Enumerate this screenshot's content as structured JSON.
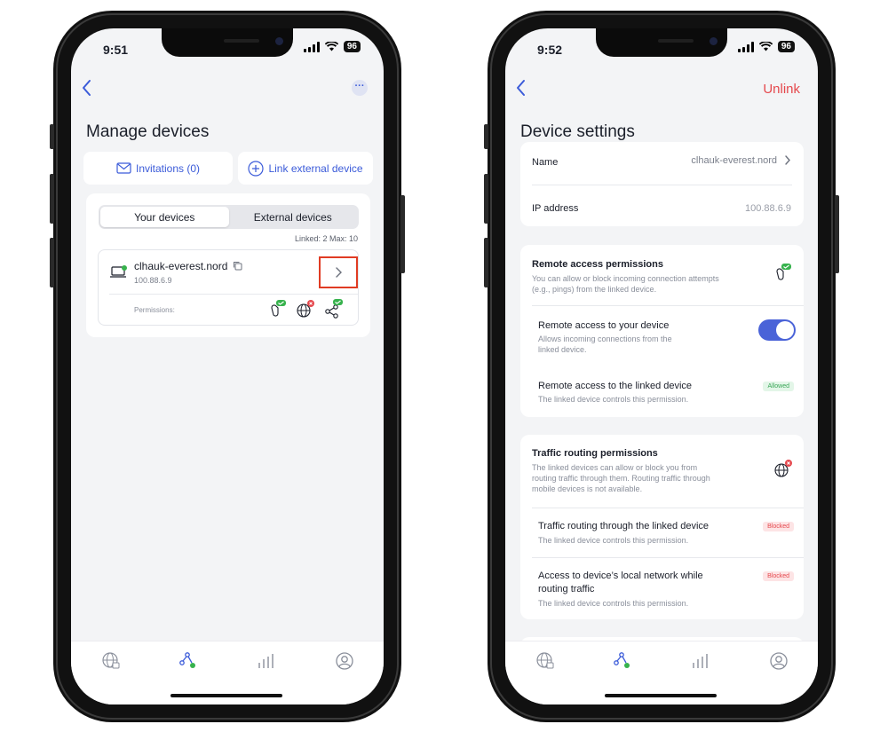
{
  "left": {
    "status": {
      "time": "9:51",
      "battery": "96"
    },
    "title": "Manage devices",
    "invitations_label": "Invitations (0)",
    "link_label": "Link external device",
    "tabs": {
      "your": "Your devices",
      "external": "External devices"
    },
    "linked_info": "Linked: 2  Max: 10",
    "device": {
      "name": "clhauk-everest.nord",
      "ip": "100.88.6.9"
    },
    "permissions_label": "Permissions:"
  },
  "right": {
    "status": {
      "time": "9:52",
      "battery": "96"
    },
    "unlink_label": "Unlink",
    "title": "Device settings",
    "name_label": "Name",
    "name_value": "clhauk-everest.nord",
    "ip_label": "IP address",
    "ip_value": "100.88.6.9",
    "remote": {
      "title": "Remote access permissions",
      "desc1": "You can allow or block incoming connection attempts",
      "desc2": "(e.g., pings) from the linked device.",
      "item1_title": "Remote access to your device",
      "item1_desc1": "Allows incoming connections from the",
      "item1_desc2": "linked device.",
      "item2_title": "Remote access to the linked device",
      "item2_desc": "The linked device controls this permission.",
      "item2_badge": "Allowed"
    },
    "traffic": {
      "title": "Traffic routing permissions",
      "desc1": "The linked devices can allow or block you from",
      "desc2": "routing traffic through them. Routing traffic through",
      "desc3": "mobile devices is not available.",
      "item1_title": "Traffic routing through the linked device",
      "item1_desc": "The linked device controls this permission.",
      "item1_badge": "Blocked",
      "item2_title1": "Access to device’s local network while",
      "item2_title2": "routing traffic",
      "item2_desc": "The linked device controls this permission.",
      "item2_badge": "Blocked"
    }
  },
  "colors": {
    "accent": "#3b5bd9",
    "danger": "#e5484d",
    "success": "#3aa657",
    "highlight": "#e03b23"
  }
}
